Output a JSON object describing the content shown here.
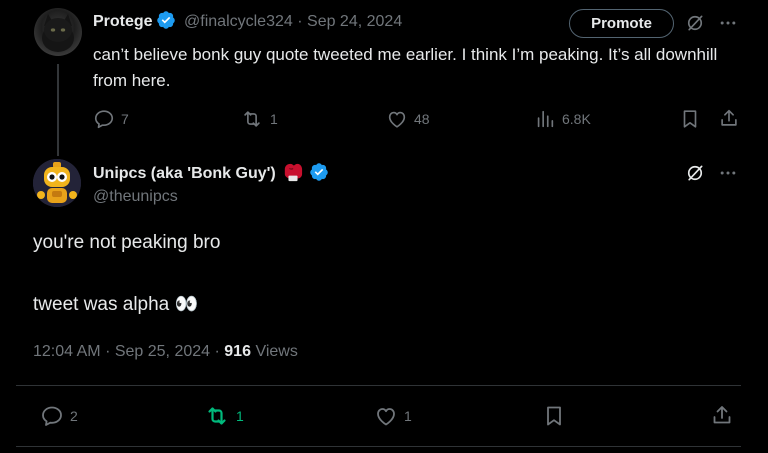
{
  "parent_tweet": {
    "display_name": "Protege",
    "handle": "@finalcycle324",
    "separator": "·",
    "date": "Sep 24, 2024",
    "promote_label": "Promote",
    "text": "can’t believe bonk guy quote tweeted me earlier. I think I’m peaking. It’s all downhill  from here.",
    "replies": "7",
    "reposts": "1",
    "likes": "48",
    "views": "6.8K"
  },
  "main_tweet": {
    "display_name": "Unipcs (aka 'Bonk Guy')",
    "handle": "@theunipcs",
    "line1": "you're not peaking bro",
    "line2": "tweet was alpha 👀",
    "time": "12:04 AM",
    "separator": "·",
    "date": "Sep 25, 2024",
    "separator2": "·",
    "views_count": "916",
    "views_label": "Views",
    "replies": "2",
    "reposts": "1",
    "likes": "1"
  },
  "colors": {
    "background": "#000000",
    "text": "#e7e9ea",
    "muted": "#71767b",
    "verified": "#1d9bf0",
    "repost_active": "#00ba7c",
    "divider": "#2f3336"
  },
  "icons": {
    "verified": "verified-badge-icon",
    "grok": "grok-icon",
    "more": "more-icon",
    "reply": "reply-icon",
    "repost": "repost-icon",
    "like": "like-icon",
    "views": "views-icon",
    "bookmark": "bookmark-icon",
    "share": "share-icon",
    "boxing_glove": "boxing-glove-icon"
  }
}
